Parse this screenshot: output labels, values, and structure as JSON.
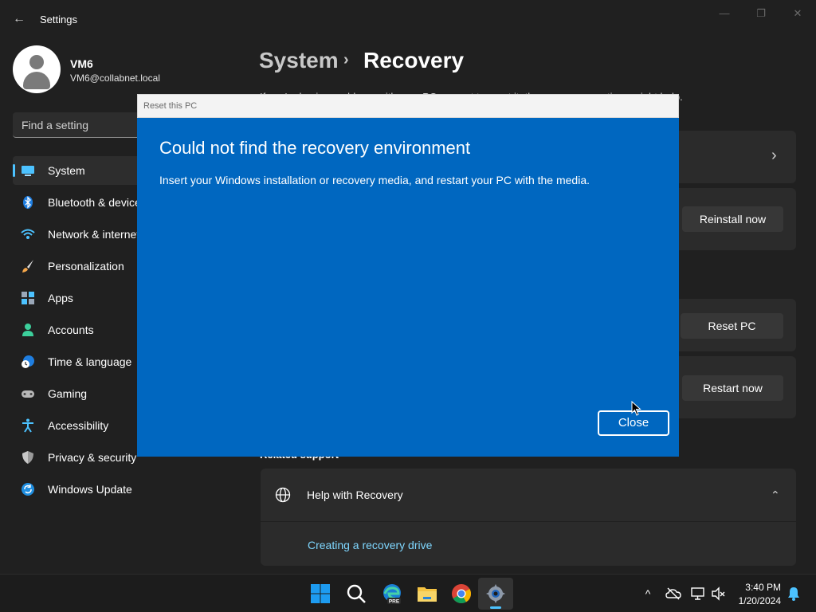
{
  "window": {
    "title": "Settings",
    "back_glyph": "←",
    "minimize_glyph": "—",
    "restore_glyph": "❐",
    "close_glyph": "✕"
  },
  "profile": {
    "name": "VM6",
    "email": "VM6@collabnet.local"
  },
  "search": {
    "placeholder": "Find a setting"
  },
  "sidebar": {
    "items": [
      {
        "label": "System",
        "icon": "system-icon",
        "selected": true
      },
      {
        "label": "Bluetooth & devices",
        "icon": "bluetooth-icon"
      },
      {
        "label": "Network & internet",
        "icon": "wifi-icon"
      },
      {
        "label": "Personalization",
        "icon": "brush-icon"
      },
      {
        "label": "Apps",
        "icon": "apps-icon"
      },
      {
        "label": "Accounts",
        "icon": "person-icon"
      },
      {
        "label": "Time & language",
        "icon": "clock-globe-icon"
      },
      {
        "label": "Gaming",
        "icon": "gamepad-icon"
      },
      {
        "label": "Accessibility",
        "icon": "accessibility-icon"
      },
      {
        "label": "Privacy & security",
        "icon": "shield-icon"
      },
      {
        "label": "Windows Update",
        "icon": "update-icon"
      }
    ]
  },
  "main": {
    "breadcrumb_parent": "System",
    "breadcrumb_sep": "›",
    "breadcrumb_current": "Recovery",
    "description": "If you're having problems with your PC or want to reset it, these recovery options might help.",
    "chevron_right": "›",
    "reinstall_button": "Reinstall now",
    "reset_button": "Reset PC",
    "restart_button": "Restart now",
    "related_heading": "Related support",
    "help_label": "Help with Recovery",
    "help_chevron": "⌃",
    "help_link": "Creating a recovery drive"
  },
  "dialog": {
    "title": "Reset this PC",
    "heading": "Could not find the recovery environment",
    "message": "Insert your Windows installation or recovery media, and restart your PC with the media.",
    "close_button": "Close"
  },
  "taskbar": {
    "apps": [
      "windows-start-icon",
      "search-icon",
      "edge-beta-icon",
      "file-explorer-icon",
      "chrome-icon",
      "settings-gear-icon"
    ],
    "edge_badge": "PRE",
    "tray_chevron": "^",
    "time": "3:40 PM",
    "date": "1/20/2024"
  },
  "colors": {
    "accent": "#4cc2ff",
    "dialog_blue": "#0067c0",
    "background": "#202020"
  }
}
